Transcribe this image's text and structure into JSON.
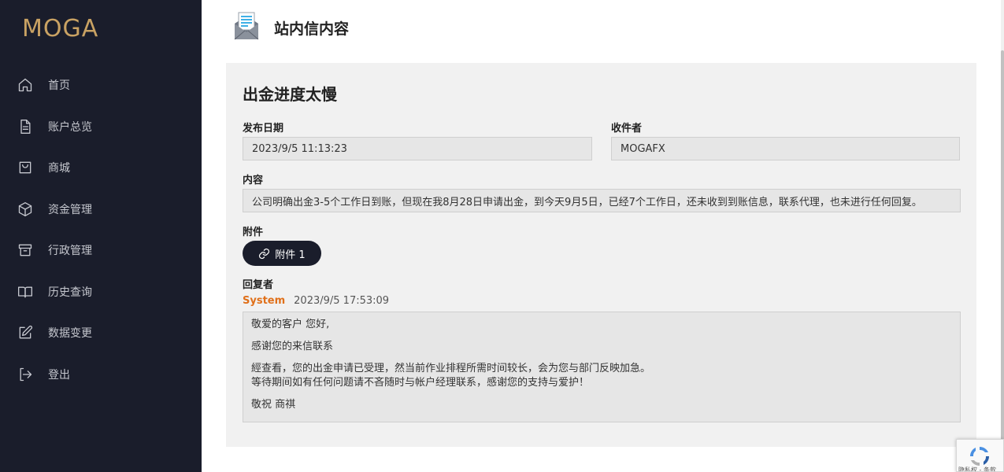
{
  "app": {
    "logo": "MOGA"
  },
  "sidebar": {
    "items": [
      {
        "label": "首页",
        "icon": "home-icon"
      },
      {
        "label": "账户总览",
        "icon": "document-icon"
      },
      {
        "label": "商城",
        "icon": "shopping-bag-icon"
      },
      {
        "label": "资金管理",
        "icon": "box-icon"
      },
      {
        "label": "行政管理",
        "icon": "archive-icon"
      },
      {
        "label": "历史查询",
        "icon": "book-icon"
      },
      {
        "label": "数据变更",
        "icon": "edit-icon"
      },
      {
        "label": "登出",
        "icon": "logout-icon"
      }
    ]
  },
  "header": {
    "title": "站内信内容",
    "icon": "mail-envelope-icon"
  },
  "message": {
    "subject": "出金进度太慢",
    "date_label": "发布日期",
    "date_value": "2023/9/5 11:13:23",
    "recipient_label": "收件者",
    "recipient_value": "MOGAFX",
    "content_label": "内容",
    "content_value": "公司明确出金3-5个工作日到账，但现在我8月28日申请出金，到今天9月5日，已经7个工作日，还未收到到账信息，联系代理，也未进行任何回复。",
    "attachment_label": "附件",
    "attachment_button": "附件 1",
    "reply_label": "回复者",
    "reply_sender": "System",
    "reply_time": "2023/9/5 17:53:09",
    "reply_lines": [
      "敬爱的客户 您好,",
      "感谢您的来信联系",
      "經查看，您的出金申请已受理，然当前作业排程所需时间较长，会为您与部门反映加急。",
      "等待期间如有任何问题请不吝随时与帐户经理联系，感谢您的支持与爱护！",
      "敬祝 商祺"
    ]
  },
  "recaptcha": {
    "text": "隐私权 - 条款"
  },
  "colors": {
    "sidebar_bg": "#1a1d2b",
    "logo_gold": "#c9a263",
    "accent_orange": "#e0701a",
    "card_bg": "#f1f1f1"
  }
}
